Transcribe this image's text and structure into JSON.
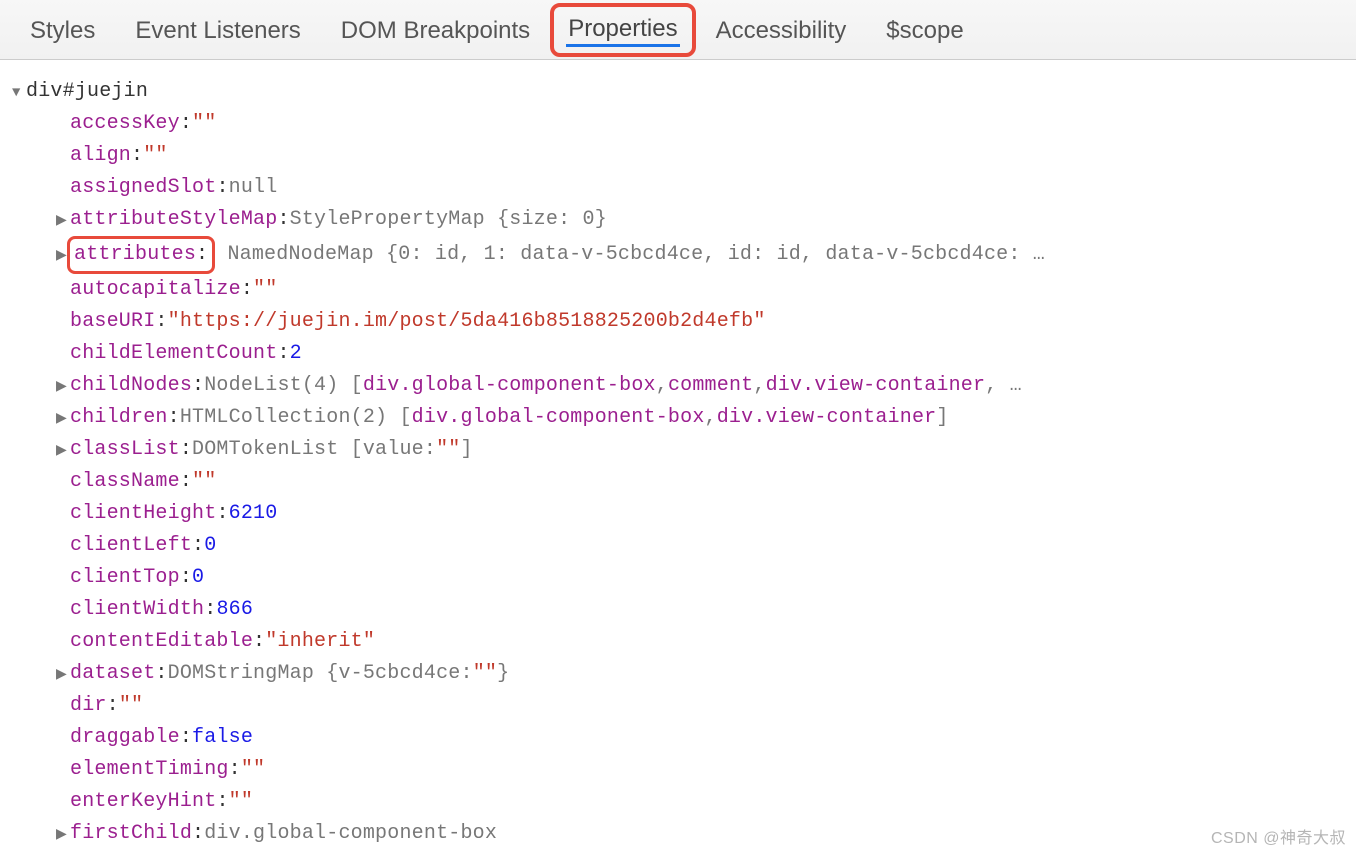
{
  "tabs": {
    "styles": "Styles",
    "event_listeners": "Event Listeners",
    "dom_breakpoints": "DOM Breakpoints",
    "properties": "Properties",
    "accessibility": "Accessibility",
    "scope": "$scope"
  },
  "header": "div#juejin",
  "props": {
    "accessKey": {
      "k": "accessKey",
      "v": "\"\""
    },
    "align": {
      "k": "align",
      "v": "\"\""
    },
    "assignedSlot": {
      "k": "assignedSlot",
      "v": "null"
    },
    "attributeStyleMap": {
      "k": "attributeStyleMap",
      "v": "StylePropertyMap {size: 0}"
    },
    "attributes": {
      "k": "attributes",
      "v": "NamedNodeMap {0: id, 1: data-v-5cbcd4ce, id: id, data-v-5cbcd4ce: …"
    },
    "autocapitalize": {
      "k": "autocapitalize",
      "v": "\"\""
    },
    "baseURI": {
      "k": "baseURI",
      "v": "\"https://juejin.im/post/5da416b8518825200b2d4efb\""
    },
    "childElementCount": {
      "k": "childElementCount",
      "v": "2"
    },
    "childNodes": {
      "k": "childNodes",
      "pre": "NodeList(4) [",
      "items": [
        "div.global-component-box",
        "comment",
        "div.view-container"
      ],
      "post": ", …"
    },
    "children": {
      "k": "children",
      "pre": "HTMLCollection(2) [",
      "items": [
        "div.global-component-box",
        "div.view-container"
      ],
      "post": "]"
    },
    "classList": {
      "k": "classList",
      "pre": "DOMTokenList [value: ",
      "val": "\"\"",
      "post": "]"
    },
    "className": {
      "k": "className",
      "v": "\"\""
    },
    "clientHeight": {
      "k": "clientHeight",
      "v": "6210"
    },
    "clientLeft": {
      "k": "clientLeft",
      "v": "0"
    },
    "clientTop": {
      "k": "clientTop",
      "v": "0"
    },
    "clientWidth": {
      "k": "clientWidth",
      "v": "866"
    },
    "contentEditable": {
      "k": "contentEditable",
      "v": "\"inherit\""
    },
    "dataset": {
      "k": "dataset",
      "pre": "DOMStringMap {v-5cbcd4ce: ",
      "val": "\"\"",
      "post": "}"
    },
    "dir": {
      "k": "dir",
      "v": "\"\""
    },
    "draggable": {
      "k": "draggable",
      "v": "false"
    },
    "elementTiming": {
      "k": "elementTiming",
      "v": "\"\""
    },
    "enterKeyHint": {
      "k": "enterKeyHint",
      "v": "\"\""
    },
    "firstChild": {
      "k": "firstChild",
      "v": "div.global-component-box"
    }
  },
  "watermark": "CSDN @神奇大叔"
}
